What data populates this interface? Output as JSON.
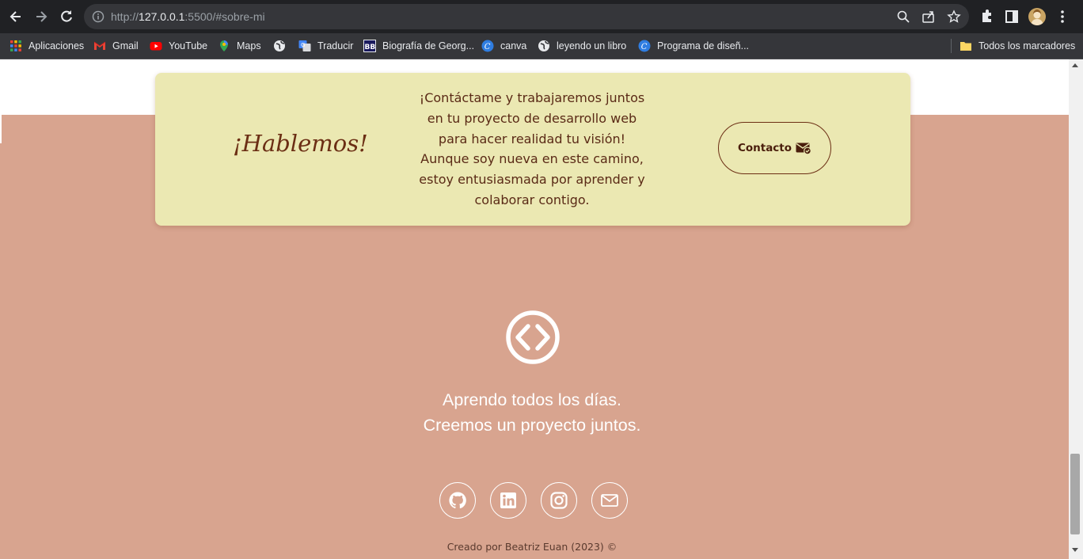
{
  "browser": {
    "url_prefix": "http://",
    "url_host": "127.0.0.1",
    "url_rest": ":5500/#sobre-mi",
    "bookmarks": [
      {
        "label": "Aplicaciones",
        "icon": "apps-grid-icon"
      },
      {
        "label": "Gmail",
        "icon": "gmail-icon"
      },
      {
        "label": "YouTube",
        "icon": "youtube-icon"
      },
      {
        "label": "Maps",
        "icon": "maps-pin-icon"
      },
      {
        "label": "",
        "icon": "globe-icon"
      },
      {
        "label": "Traducir",
        "icon": "translate-icon"
      },
      {
        "label": "Biografía de Georg...",
        "icon": "bb-icon"
      },
      {
        "label": "canva",
        "icon": "canva-icon"
      },
      {
        "label": "leyendo un libro",
        "icon": "globe-icon"
      },
      {
        "label": "Programa de diseñ...",
        "icon": "canva-icon"
      }
    ],
    "all_bookmarks_label": "Todos los marcadores"
  },
  "contact": {
    "title": "¡Hablemos!",
    "text": "¡Contáctame y trabajaremos juntos en tu proyecto de desarrollo web para hacer realidad tu visión! Aunque soy nueva en este camino, estoy entusiasmada por aprender y colaborar contigo.",
    "button_label": "Contacto"
  },
  "footer": {
    "tagline_line1": "Aprendo todos los días.",
    "tagline_line2": "Creemos un proyecto juntos.",
    "socials": [
      "github-icon",
      "linkedin-icon",
      "instagram-icon",
      "mail-icon"
    ],
    "credit": "Creado por Beatriz Euan (2023) ©"
  },
  "colors": {
    "page_bg": "#d8a48f",
    "card_bg": "#ebe8b2",
    "accent_brown": "#6b2e14",
    "browser_dark": "#202124"
  }
}
